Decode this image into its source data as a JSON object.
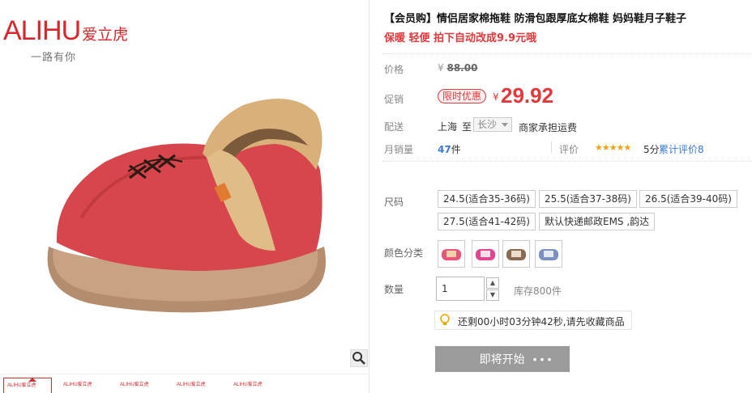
{
  "brand": {
    "name_latin": "ALIHU",
    "name_cn": "爱立虎",
    "slogan": "一路有你"
  },
  "product": {
    "title": "【会员购】情侣居家棉拖鞋 防滑包跟厚底女棉鞋 妈妈鞋月子鞋子",
    "subtitle": "保暖 轻便 拍下自动改成9.9元哦"
  },
  "price": {
    "label": "价格",
    "currency": "¥",
    "original": "88.00",
    "promo_label": "促销",
    "promo_tag": "限时优惠",
    "promo_price": "29.92"
  },
  "shipping": {
    "label": "配送",
    "from": "上海",
    "to_word": "至",
    "to_city": "长沙",
    "fee_note": "商家承担运费"
  },
  "sales": {
    "label": "月销量",
    "count": "47",
    "unit": "件",
    "rating_label": "评价",
    "stars": "★★★★★",
    "score": "5分",
    "review_link": "累计评价8"
  },
  "sku": {
    "size_label": "尺码",
    "sizes": [
      "24.5(适合35-36码)",
      "25.5(适合37-38码)",
      "26.5(适合39-40码)",
      "27.5(适合41-42码)",
      "默认快递邮政EMS ,韵达"
    ],
    "color_label": "颜色分类",
    "colors": [
      "#e8557a",
      "#e2458f",
      "#8a6a52",
      "#7b8fc0"
    ],
    "qty_label": "数量",
    "qty_value": "1",
    "stock": "库存800件"
  },
  "notice": {
    "text": "还剩00小时03分钟42秒,请先收藏商品"
  },
  "cta": {
    "label": "即将开始",
    "dots": "•••"
  },
  "thumbs": [
    "ALIHU爱立虎",
    "ALIHU爱立虎",
    "ALIHU爱立虎",
    "ALIHU爱立虎",
    "ALIHU爱立虎"
  ]
}
